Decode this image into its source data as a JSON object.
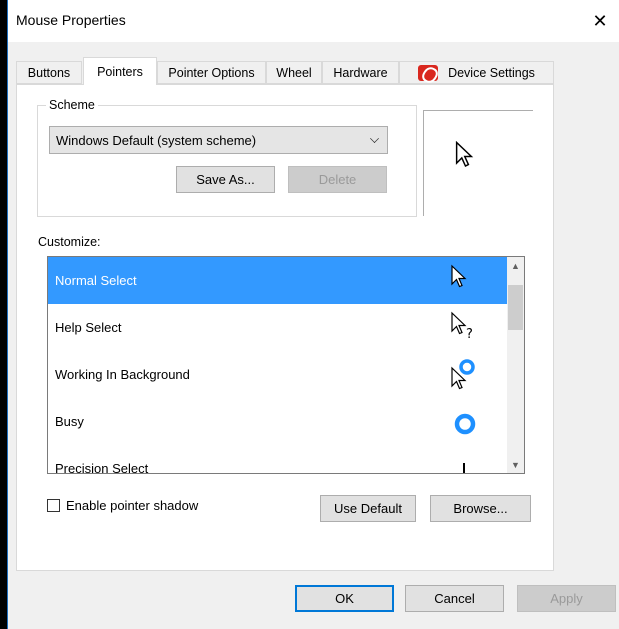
{
  "window": {
    "title": "Mouse Properties",
    "close_glyph": "✕"
  },
  "tabs": [
    {
      "label": "Buttons",
      "active": false
    },
    {
      "label": "Pointers",
      "active": true
    },
    {
      "label": "Pointer Options",
      "active": false
    },
    {
      "label": "Wheel",
      "active": false
    },
    {
      "label": "Hardware",
      "active": false
    },
    {
      "label": "Device Settings",
      "active": false,
      "icon": "synaptics-icon"
    }
  ],
  "scheme": {
    "group_label": "Scheme",
    "selected": "Windows Default (system scheme)",
    "save_as_label": "Save As...",
    "delete_label": "Delete"
  },
  "customize": {
    "label": "Customize:",
    "items": [
      {
        "label": "Normal Select",
        "selected": true,
        "cursor": "arrow-cursor-icon"
      },
      {
        "label": "Help Select",
        "selected": false,
        "cursor": "help-cursor-icon"
      },
      {
        "label": "Working In Background",
        "selected": false,
        "cursor": "working-cursor-icon"
      },
      {
        "label": "Busy",
        "selected": false,
        "cursor": "busy-cursor-icon"
      },
      {
        "label": "Precision Select",
        "selected": false,
        "cursor": "crosshair-cursor-icon"
      }
    ]
  },
  "options": {
    "shadow_label": "Enable pointer shadow",
    "shadow_checked": false,
    "use_default_label": "Use Default",
    "browse_label": "Browse..."
  },
  "footer": {
    "ok_label": "OK",
    "cancel_label": "Cancel",
    "apply_label": "Apply"
  },
  "colors": {
    "selection": "#3399ff",
    "accent": "#0078d7",
    "busy_ring": "#1e90ff"
  }
}
